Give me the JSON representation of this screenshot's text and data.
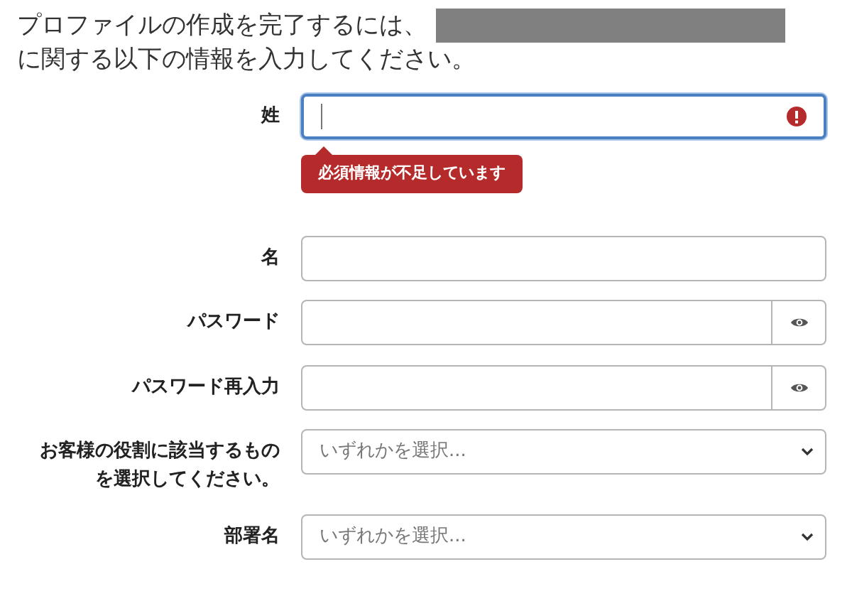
{
  "intro": {
    "before": "プロファイルの作成を完了するには、",
    "after": "に関する以下の情報を入力してください。"
  },
  "fields": [
    {
      "kind": "text",
      "label": "姓",
      "focused": true,
      "error": "必須情報が不足しています"
    },
    {
      "kind": "text",
      "label": "名",
      "focused": false
    },
    {
      "kind": "password",
      "label": "パスワード",
      "focused": false
    },
    {
      "kind": "password",
      "label": "パスワード再入力",
      "focused": false
    },
    {
      "kind": "select",
      "label": "お客様の役割に該当するものを選択してください。",
      "placeholder": "いずれかを選択...",
      "focused": false
    },
    {
      "kind": "select",
      "label": "部署名",
      "placeholder": "いずれかを選択...",
      "focused": false
    }
  ]
}
